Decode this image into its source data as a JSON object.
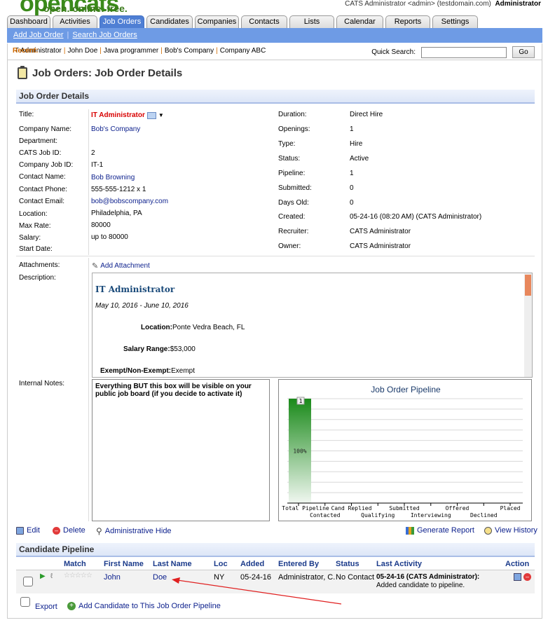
{
  "brand": {
    "logo": "opencats",
    "tagline": "open. online. free."
  },
  "user": {
    "info": "CATS Administrator <admin> (testdomain.com)",
    "role": "Administrator"
  },
  "tabs": [
    "Dashboard",
    "Activities",
    "Job Orders",
    "Candidates",
    "Companies",
    "Contacts",
    "Lists",
    "Calendar",
    "Reports",
    "Settings"
  ],
  "active_tab": "Job Orders",
  "subnav": {
    "add": "Add Job Order",
    "search": "Search Job Orders"
  },
  "recent": {
    "label": "Recent:",
    "items": [
      "IT Administrator",
      "John Doe",
      "Java programmer",
      "Bob's Company",
      "Company ABC"
    ]
  },
  "quick_search": {
    "label": "Quick Search:",
    "value": "",
    "button": "Go"
  },
  "page_title": "Job Orders: Job Order Details",
  "section_details": "Job Order Details",
  "left_fields": [
    {
      "label": "Title:",
      "value": "IT Administrator"
    },
    {
      "label": "Company Name:",
      "value": "Bob's Company"
    },
    {
      "label": "Department:",
      "value": ""
    },
    {
      "label": "CATS Job ID:",
      "value": "2"
    },
    {
      "label": "Company Job ID:",
      "value": "IT-1"
    },
    {
      "label": "Contact Name:",
      "value": "Bob Browning"
    },
    {
      "label": "Contact Phone:",
      "value": "555-555-1212 x 1"
    },
    {
      "label": "Contact Email:",
      "value": "bob@bobscompany.com"
    },
    {
      "label": "Location:",
      "value": "Philadelphia, PA"
    },
    {
      "label": "Max Rate:",
      "value": "80000"
    },
    {
      "label": "Salary:",
      "value": "up to 80000"
    },
    {
      "label": "Start Date:",
      "value": ""
    }
  ],
  "right_fields": [
    {
      "label": "Duration:",
      "value": "Direct Hire"
    },
    {
      "label": "Openings:",
      "value": "1"
    },
    {
      "label": "Type:",
      "value": "Hire"
    },
    {
      "label": "Status:",
      "value": "Active"
    },
    {
      "label": "Pipeline:",
      "value": "1"
    },
    {
      "label": "Submitted:",
      "value": "0"
    },
    {
      "label": "Days Old:",
      "value": "0"
    },
    {
      "label": "Created:",
      "value": "05-24-16 (08:20 AM) (CATS Administrator)"
    },
    {
      "label": "Recruiter:",
      "value": "CATS Administrator"
    },
    {
      "label": "Owner:",
      "value": "CATS Administrator"
    }
  ],
  "attachments": {
    "label": "Attachments:",
    "add": "Add Attachment"
  },
  "description": {
    "label": "Description:",
    "title": "IT Administrator",
    "dates": "May 10, 2016 - June 10, 2016",
    "location_label": "Location:",
    "location": "Ponte Vedra Beach, FL",
    "salary_label": "Salary Range:",
    "salary": "$53,000",
    "exempt_label": "Exempt/Non-Exempt:",
    "exempt": "Exempt"
  },
  "internal_notes": {
    "label": "Internal Notes:",
    "text": "Everything BUT this box will be visible on your public job board (if you decide to activate it)"
  },
  "chart_data": {
    "type": "bar",
    "title": "Job Order Pipeline",
    "categories": [
      "Total Pipeline",
      "Contacted",
      "Cand Replied",
      "Qualifying",
      "Submitted",
      "Interviewing",
      "Offered",
      "Declined",
      "Placed"
    ],
    "values": [
      1,
      0,
      0,
      0,
      0,
      0,
      0,
      0,
      0
    ],
    "data_labels": [
      "1"
    ],
    "percent_label": "100%",
    "colors": {
      "bar_top": "#1a8a1a",
      "bar_bottom": "#f0f7f0"
    }
  },
  "actions": {
    "edit": "Edit",
    "delete": "Delete",
    "hide": "Administrative Hide",
    "report": "Generate Report",
    "history": "View History"
  },
  "section_pipeline": "Candidate Pipeline",
  "pipeline": {
    "headers": [
      "Match",
      "First Name",
      "Last Name",
      "Loc",
      "Added",
      "Entered By",
      "Status",
      "Last Activity",
      "Action"
    ],
    "rows": [
      {
        "first": "John",
        "last": "Doe",
        "loc": "NY",
        "added": "05-24-16",
        "entered_by": "Administrator, C.",
        "status": "No Contact",
        "activity_head": "05-24-16 (CATS Administrator):",
        "activity_body": "Added candidate to pipeline."
      }
    ]
  },
  "footer": {
    "export": "Export",
    "add_candidate": "Add Candidate to This Job Order Pipeline"
  }
}
